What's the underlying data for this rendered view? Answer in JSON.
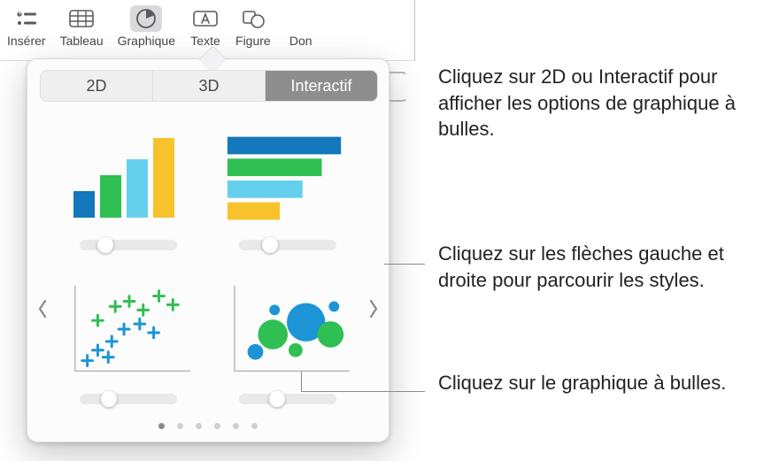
{
  "toolbar": {
    "items": [
      {
        "label": "Insérer"
      },
      {
        "label": "Tableau"
      },
      {
        "label": "Graphique"
      },
      {
        "label": "Texte"
      },
      {
        "label": "Figure"
      },
      {
        "label": "Don"
      }
    ],
    "active_index": 2
  },
  "popover": {
    "segments": [
      "2D",
      "3D",
      "Interactif"
    ],
    "selected_segment": 2,
    "page_dots": 6,
    "active_dot": 0,
    "thumbs": [
      {
        "name": "bar-chart-vertical",
        "slider_pos": 0.25
      },
      {
        "name": "bar-chart-horizontal",
        "slider_pos": 0.3
      },
      {
        "name": "scatter-plus-chart",
        "slider_pos": 0.28
      },
      {
        "name": "bubble-chart",
        "slider_pos": 0.38
      }
    ]
  },
  "callouts": {
    "top": "Cliquez sur 2D ou Interactif pour afficher les options de graphique à bulles.",
    "mid": "Cliquez sur les flèches gauche et droite pour parcourir les styles.",
    "bot": "Cliquez sur le graphique à bulles."
  }
}
